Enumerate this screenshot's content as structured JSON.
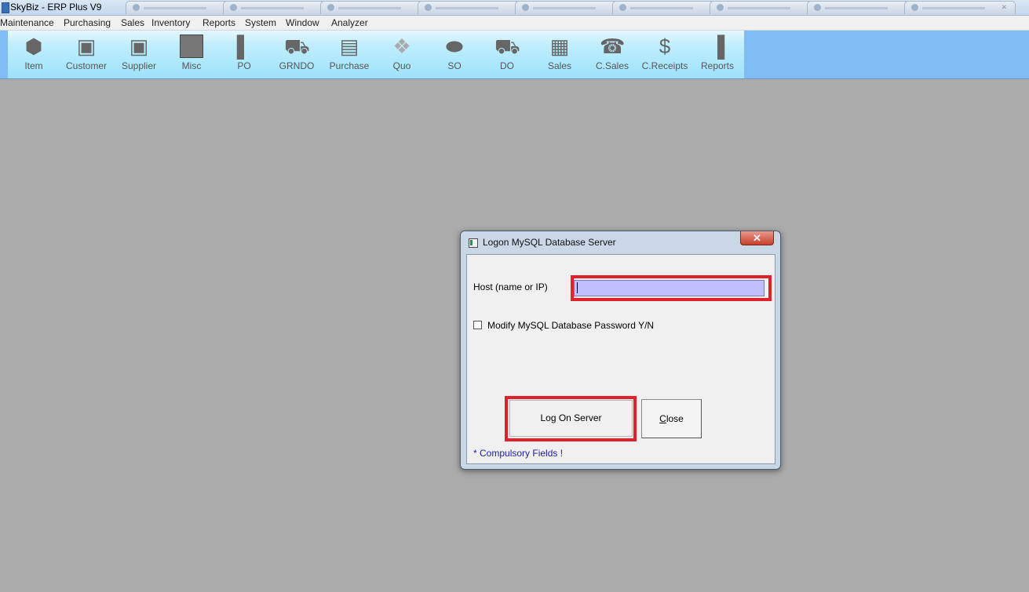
{
  "window": {
    "title": "SkyBiz - ERP Plus V9"
  },
  "menu": [
    "Maintenance",
    "Purchasing",
    "Sales",
    "Inventory",
    "Reports",
    "System",
    "Window",
    "Analyzer"
  ],
  "toolbar": [
    {
      "label": "Item",
      "icon": "item-icon"
    },
    {
      "label": "Customer",
      "icon": "customer-icon"
    },
    {
      "label": "Supplier",
      "icon": "supplier-icon"
    },
    {
      "label": "Misc",
      "icon": "misc-icon"
    },
    {
      "label": "PO",
      "icon": "po-icon"
    },
    {
      "label": "GRNDO",
      "icon": "grndo-icon"
    },
    {
      "label": "Purchase",
      "icon": "purchase-icon"
    },
    {
      "label": "Quo",
      "icon": "quo-icon"
    },
    {
      "label": "SO",
      "icon": "so-icon"
    },
    {
      "label": "DO",
      "icon": "do-icon"
    },
    {
      "label": "Sales",
      "icon": "sales-icon"
    },
    {
      "label": "C.Sales",
      "icon": "cash-sales-icon"
    },
    {
      "label": "C.Receipts",
      "icon": "cash-receipts-icon"
    },
    {
      "label": "Reports",
      "icon": "reports-icon"
    }
  ],
  "dialog": {
    "title": "Logon MySQL Database Server",
    "close_glyph": "✕",
    "host_label": "Host (name or IP)",
    "host_value": "",
    "modify_password_label": "Modify MySQL Database Password Y/N",
    "modify_password_checked": false,
    "logon_button": "Log On Server",
    "close_button_first": "C",
    "close_button_rest": "lose",
    "compulsory_note": "* Compulsory Fields !"
  },
  "colors": {
    "desktop": "#ababab",
    "toolbar": "#7fbdf4",
    "highlight": "#e0202b",
    "host_input": "#c0c0ff",
    "note_text": "#1a1aa8"
  }
}
